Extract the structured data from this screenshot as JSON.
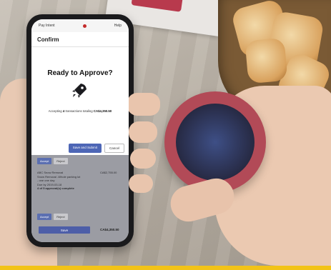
{
  "status_bar": {
    "left": "Pay Intent",
    "right": "Help"
  },
  "modal": {
    "header": "Confirm",
    "title": "Ready to Approve?",
    "message_prefix": "Accepting",
    "message_count": "4",
    "message_suffix": "transactions totaling",
    "message_total": "CA$4,350.50",
    "primary_button": "Save and Submit",
    "secondary_button": "Cancel"
  },
  "background_list": {
    "accept_label": "Accept",
    "reject_label": "Reject",
    "item_line1": "ABC Snow Removal",
    "item_line2": "Snow Removal -Whole parking lot",
    "item_line3": "- one one day",
    "item_line4": "Due by 2019-03-18",
    "item_line5": "4 of 5 approval(s) complete",
    "item_amount": "CA$2,755.00",
    "accept_label_2": "Accept",
    "reject_label_2": "Reject",
    "save_label": "Save",
    "total_label": "CA$4,350.50"
  },
  "colors": {
    "accent": "#f2c318",
    "primary_button": "#4d66b6",
    "cup": "#b24a57"
  },
  "icons": {
    "modal_icon": "rocket-icon"
  }
}
